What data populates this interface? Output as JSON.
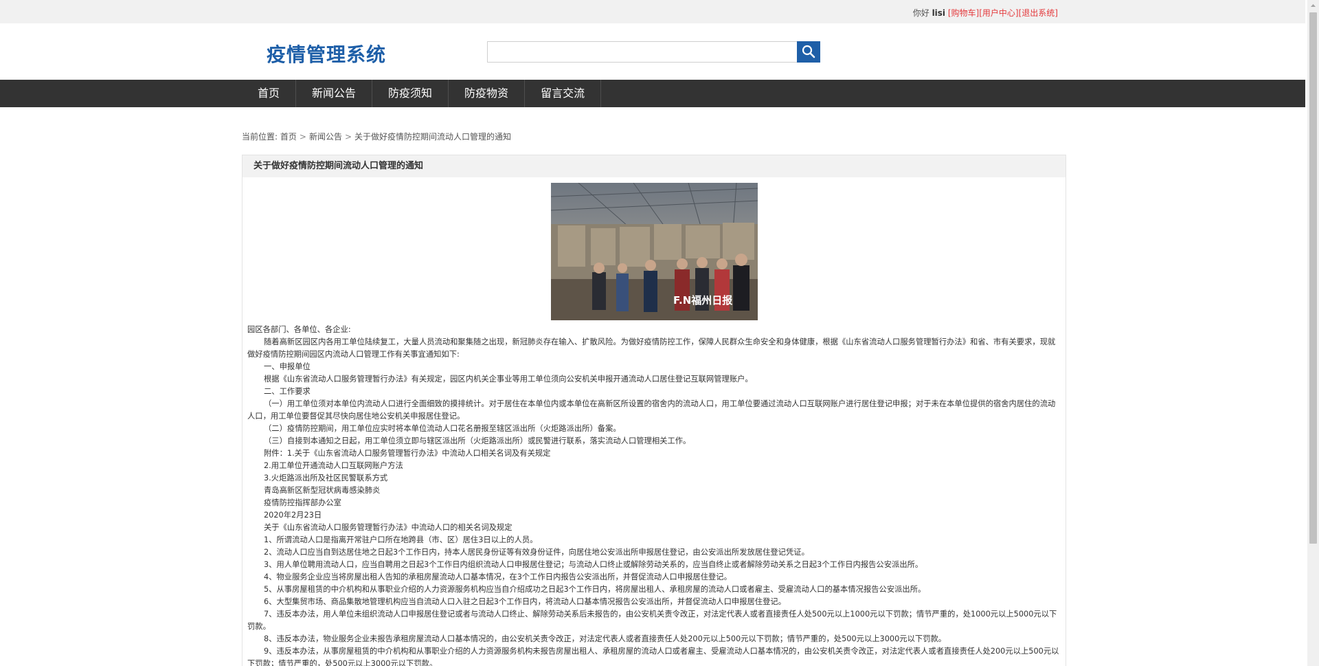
{
  "topbar": {
    "greeting": "你好",
    "username": "lisi",
    "links": [
      "[购物车]",
      "[用户中心]",
      "[退出系统]"
    ]
  },
  "header": {
    "logo": "疫情管理系统",
    "search_placeholder": ""
  },
  "nav": {
    "items": [
      "首页",
      "新闻公告",
      "防疫须知",
      "防疫物资",
      "留言交流"
    ]
  },
  "breadcrumb": {
    "prefix": "当前位置:",
    "items": [
      "首页",
      "新闻公告",
      "关于做好疫情防控期间流动人口管理的通知"
    ]
  },
  "article": {
    "title": "关于做好疫情防控期间流动人口管理的通知",
    "image_caption": "F.N福州日报",
    "paragraphs": [
      "园区各部门、各单位、各企业:",
      "随着高新区园区内各用工单位陆续复工，大量人员流动和聚集随之出现，新冠肺炎存在输入、扩散风险。为做好疫情防控工作，保障人民群众生命安全和身体健康，根据《山东省流动人口服务管理暂行办法》和省、市有关要求，现就做好疫情防控期间园区内流动人口管理工作有关事宜通知如下:",
      "一、申报单位",
      "根据《山东省流动人口服务管理暂行办法》有关规定，园区内机关企事业等用工单位须向公安机关申报开通流动人口居住登记互联网管理账户。",
      "二、工作要求",
      "（一）用工单位须对本单位内流动人口进行全面细致的摸排统计。对于居住在本单位内或本单位在高新区所设置的宿舍内的流动人口，用工单位要通过流动人口互联网账户进行居住登记申报；对于未在本单位提供的宿舍内居住的流动人口，用工单位要督促其尽快向居住地公安机关申报居住登记。",
      "（二）疫情防控期间，用工单位应实时将本单位流动人口花名册报至辖区派出所（火炬路派出所）备案。",
      "（三）自接到本通知之日起，用工单位须立即与辖区派出所（火炬路派出所）或民警进行联系，落实流动人口管理相关工作。",
      "附件：1.关于《山东省流动人口服务管理暂行办法》中流动人口相关名词及有关规定",
      "2.用工单位开通流动人口互联网账户方法",
      "3.火炬路派出所及社区民警联系方式",
      "青岛高新区新型冠状病毒感染肺炎",
      "疫情防控指挥部办公室",
      "2020年2月23日",
      "关于《山东省流动人口服务管理暂行办法》中流动人口的相关名词及规定",
      "1、所谓流动人口是指离开常驻户口所在地跨县（市、区）居住3日以上的人员。",
      "2、流动人口应当自到达居住地之日起3个工作日内，持本人居民身份证等有效身份证件，向居住地公安派出所申报居住登记，由公安派出所发放居住登记凭证。",
      "3、用人单位聘用流动人口，应当自聘用之日起3个工作日内组织流动人口申报居住登记；与流动人口终止或解除劳动关系的，应当自终止或者解除劳动关系之日起3个工作日内报告公安派出所。",
      "4、物业服务企业应当将房屋出租人告知的承租房屋流动人口基本情况，在3个工作日内报告公安派出所，并督促流动人口申报居住登记。",
      "5、从事房屋租赁的中介机构和从事职业介绍的人力资源服务机构应当自介绍成功之日起3个工作日内，将房屋出租人、承租房屋的流动人口或者雇主、受雇流动人口的基本情况报告公安派出所。",
      "6、大型集贸市场、商品集散地管理机构应当自流动人口入驻之日起3个工作日内，将流动人口基本情况报告公安派出所，并督促流动人口申报居住登记。",
      "7、违反本办法，用人单位未组织流动人口申报居住登记或者与流动人口终止、解除劳动关系后未报告的，由公安机关责令改正，对法定代表人或者直接责任人处500元以上1000元以下罚款；情节严重的，处1000元以上5000元以下罚款。",
      "8、违反本办法，物业服务企业未报告承租房屋流动人口基本情况的，由公安机关责令改正，对法定代表人或者直接责任人处200元以上500元以下罚款；情节严重的，处500元以上3000元以下罚款。",
      "9、违反本办法，从事房屋租赁的中介机构和从事职业介绍的人力资源服务机构未报告房屋出租人、承租房屋的流动人口或者雇主、受雇流动人口基本情况的，由公安机关责令改正，对法定代表人或者直接责任人处200元以上500元以下罚款；情节严重的，处500元以上3000元以下罚款。"
    ]
  },
  "colors": {
    "brand": "#1e5fa8",
    "nav_bg": "#333333",
    "link_red": "#e4393c"
  }
}
